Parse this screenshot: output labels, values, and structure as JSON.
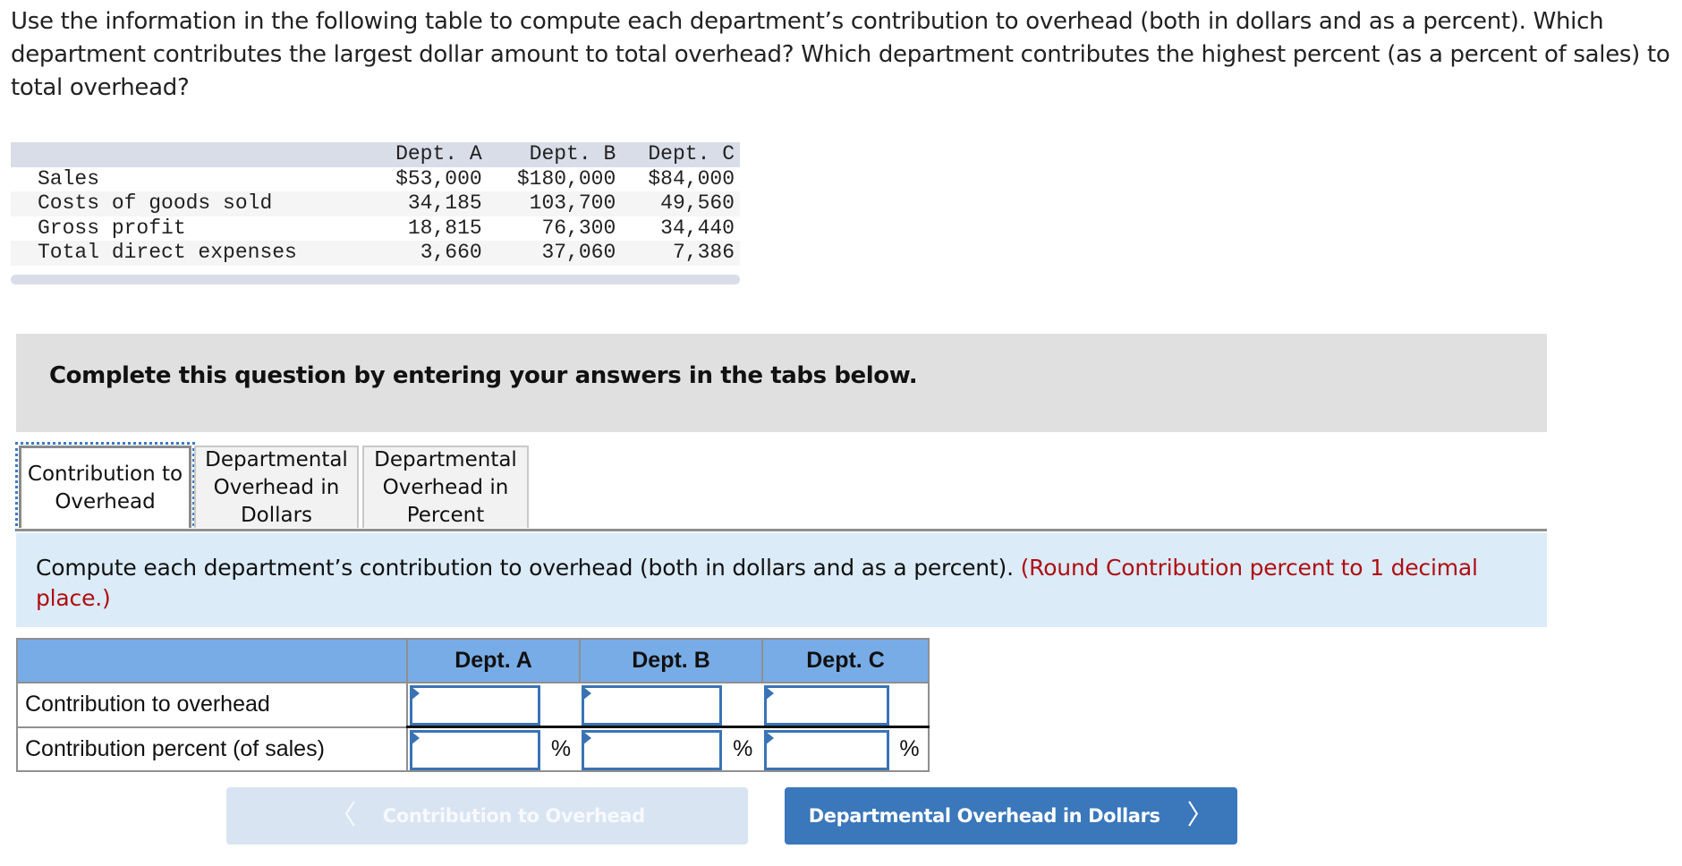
{
  "question": {
    "text": "Use the information in the following table to compute each department’s contribution to overhead (both in dollars and as a percent). Which department contributes the largest dollar amount to total overhead? Which department contributes the highest percent (as a percent of sales) to total overhead?"
  },
  "given_table": {
    "columns": [
      "",
      "Dept. A",
      "Dept. B",
      "Dept. C"
    ],
    "rows": [
      {
        "label": "Sales",
        "values": [
          "$53,000",
          "$180,000",
          "$84,000"
        ]
      },
      {
        "label": "Costs of goods sold",
        "values": [
          "34,185",
          "103,700",
          "49,560"
        ]
      },
      {
        "label": "Gross profit",
        "values": [
          "18,815",
          "76,300",
          "34,440"
        ]
      },
      {
        "label": "Total direct expenses",
        "values": [
          "3,660",
          "37,060",
          "7,386"
        ]
      }
    ]
  },
  "banner": {
    "text": "Complete this question by entering your answers in the tabs below."
  },
  "tabs": [
    {
      "label_line1": "Contribution to",
      "label_line2": "Overhead",
      "label_line3": "",
      "active": true
    },
    {
      "label_line1": "Departmental",
      "label_line2": "Overhead in",
      "label_line3": "Dollars",
      "active": false
    },
    {
      "label_line1": "Departmental",
      "label_line2": "Overhead in",
      "label_line3": "Percent",
      "active": false
    }
  ],
  "instruction": {
    "text": "Compute each department’s contribution to overhead (both in dollars and as a percent).",
    "note": "(Round Contribution percent to 1 decimal place.)"
  },
  "answer_table": {
    "columns": [
      "",
      "Dept. A",
      "Dept. B",
      "Dept. C"
    ],
    "rows": [
      {
        "label": "Contribution to overhead",
        "values": [
          "",
          "",
          ""
        ],
        "unit": ""
      },
      {
        "label": "Contribution percent (of sales)",
        "values": [
          "",
          "",
          ""
        ],
        "unit": "%"
      }
    ]
  },
  "navigation": {
    "prev_label": "Contribution to Overhead",
    "prev_enabled": false,
    "next_label": "Departmental Overhead in Dollars",
    "next_enabled": true,
    "prev_icon": "chevron-left",
    "next_icon": "chevron-right"
  },
  "colors": {
    "accent": "#3a77bb",
    "header_blue": "#78ace6",
    "instruction_bg": "#dbebf8",
    "note_red": "#b00d12"
  }
}
